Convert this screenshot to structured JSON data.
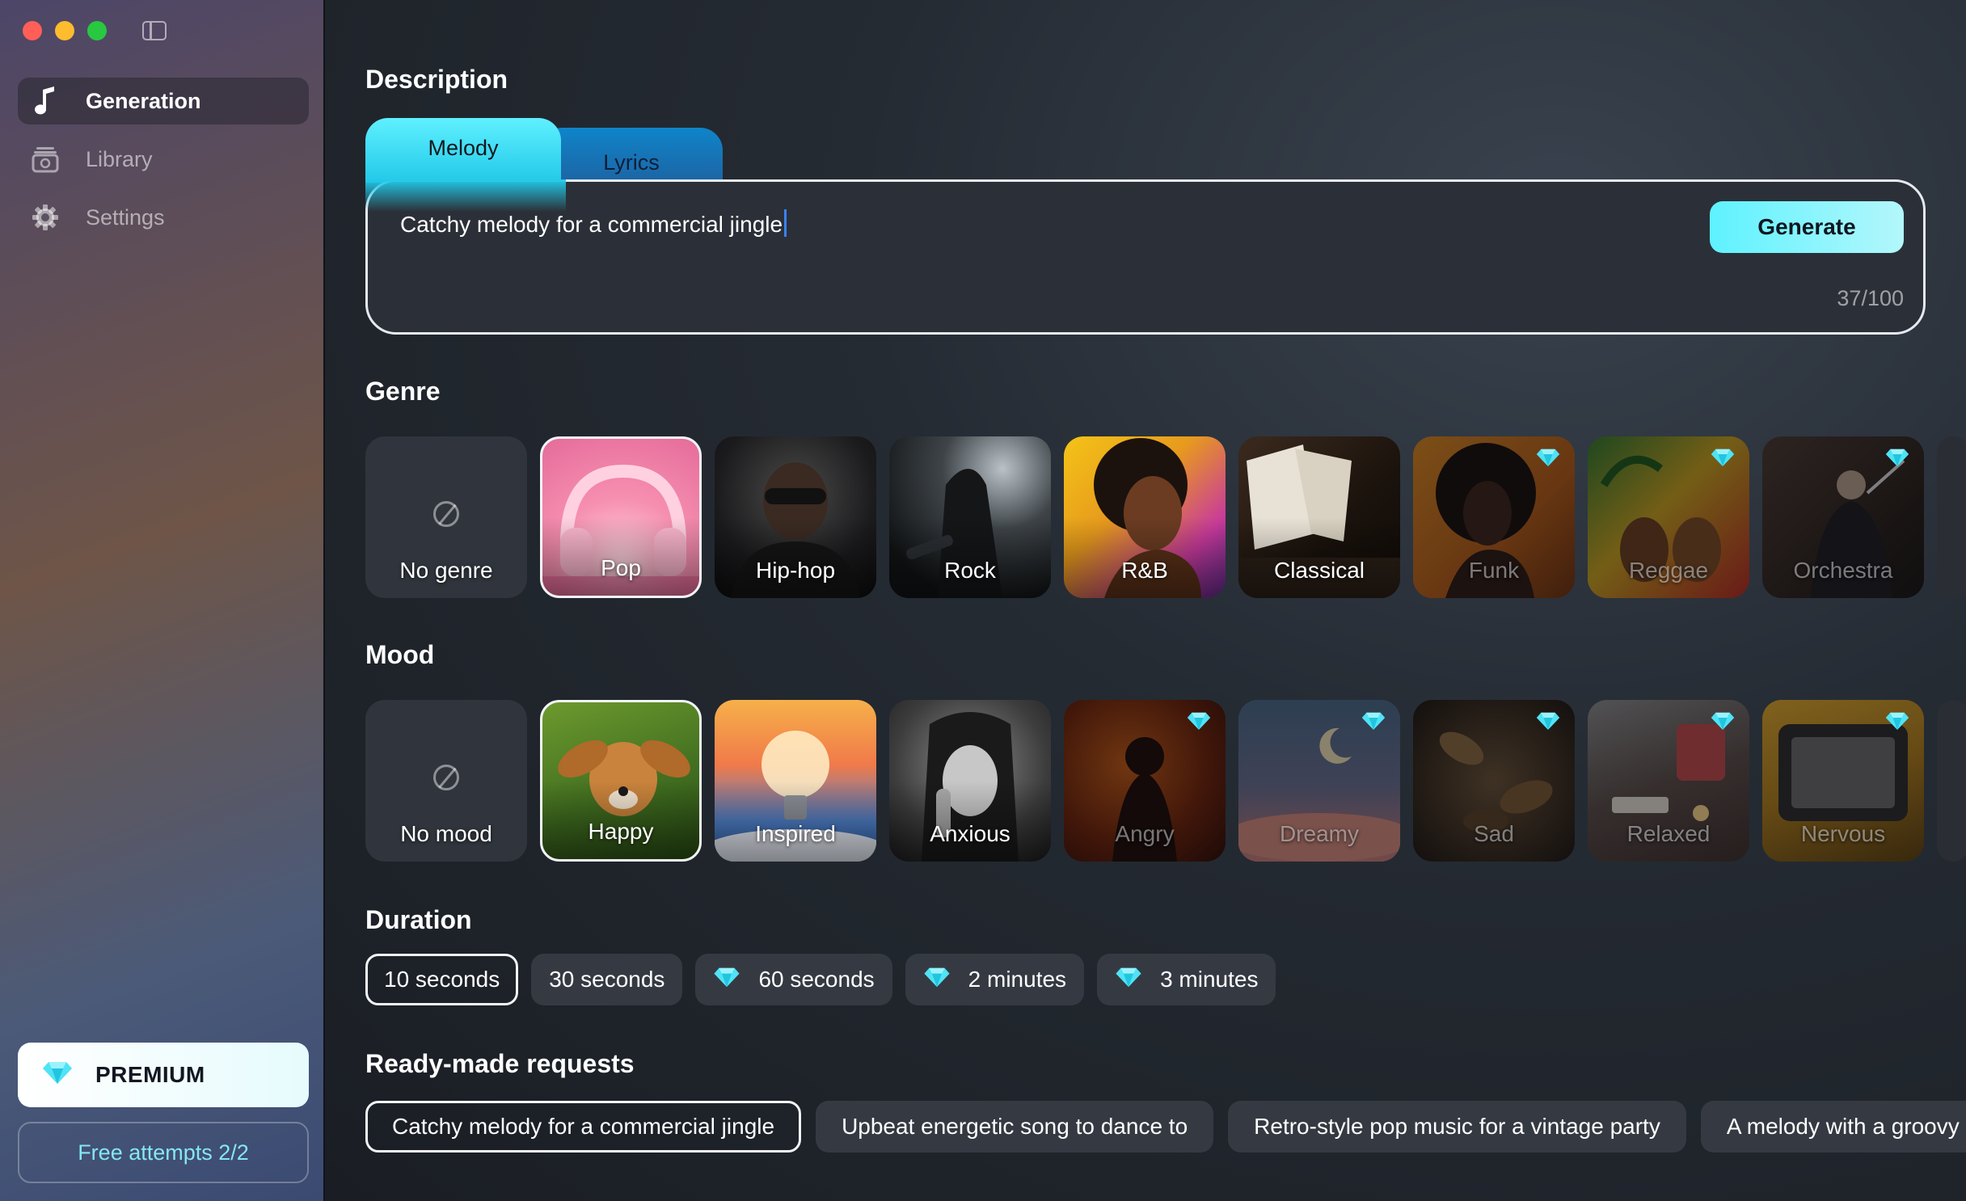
{
  "sidebar": {
    "nav": [
      {
        "label": "Generation",
        "icon": "music-note-icon",
        "active": true
      },
      {
        "label": "Library",
        "icon": "library-icon",
        "active": false
      },
      {
        "label": "Settings",
        "icon": "gear-icon",
        "active": false
      }
    ],
    "premium_label": "PREMIUM",
    "free_attempts": "Free attempts 2/2"
  },
  "description": {
    "title": "Description",
    "tabs": [
      {
        "label": "Melody",
        "active": true
      },
      {
        "label": "Lyrics",
        "active": false
      }
    ],
    "input_value": "Catchy melody for a commercial jingle",
    "generate_label": "Generate",
    "char_count": "37/100"
  },
  "genre": {
    "title": "Genre",
    "items": [
      {
        "label": "No genre",
        "selected": false,
        "locked": false
      },
      {
        "label": "Pop",
        "selected": true,
        "locked": false
      },
      {
        "label": "Hip-hop",
        "selected": false,
        "locked": false
      },
      {
        "label": "Rock",
        "selected": false,
        "locked": false
      },
      {
        "label": "R&B",
        "selected": false,
        "locked": false
      },
      {
        "label": "Classical",
        "selected": false,
        "locked": false
      },
      {
        "label": "Funk",
        "selected": false,
        "locked": true
      },
      {
        "label": "Reggae",
        "selected": false,
        "locked": true
      },
      {
        "label": "Orchestra",
        "selected": false,
        "locked": true
      }
    ]
  },
  "mood": {
    "title": "Mood",
    "items": [
      {
        "label": "No mood",
        "selected": false,
        "locked": false
      },
      {
        "label": "Happy",
        "selected": true,
        "locked": false
      },
      {
        "label": "Inspired",
        "selected": false,
        "locked": false
      },
      {
        "label": "Anxious",
        "selected": false,
        "locked": false
      },
      {
        "label": "Angry",
        "selected": false,
        "locked": true
      },
      {
        "label": "Dreamy",
        "selected": false,
        "locked": true
      },
      {
        "label": "Sad",
        "selected": false,
        "locked": true
      },
      {
        "label": "Relaxed",
        "selected": false,
        "locked": true
      },
      {
        "label": "Nervous",
        "selected": false,
        "locked": true
      }
    ]
  },
  "duration": {
    "title": "Duration",
    "options": [
      {
        "label": "10 seconds",
        "selected": true,
        "premium": false
      },
      {
        "label": "30 seconds",
        "selected": false,
        "premium": false
      },
      {
        "label": "60 seconds",
        "selected": false,
        "premium": true
      },
      {
        "label": "2 minutes",
        "selected": false,
        "premium": true
      },
      {
        "label": "3 minutes",
        "selected": false,
        "premium": true
      }
    ]
  },
  "requests": {
    "title": "Ready-made requests",
    "items": [
      {
        "label": "Catchy melody for a commercial jingle",
        "selected": true
      },
      {
        "label": "Upbeat energetic song to dance to",
        "selected": false
      },
      {
        "label": "Retro-style pop music for a vintage party",
        "selected": false
      },
      {
        "label": "A melody with a groovy rhythm",
        "selected": false
      }
    ]
  },
  "colors": {
    "accent": "#5ef2ff",
    "premium_gem": "#4fe3f5"
  }
}
